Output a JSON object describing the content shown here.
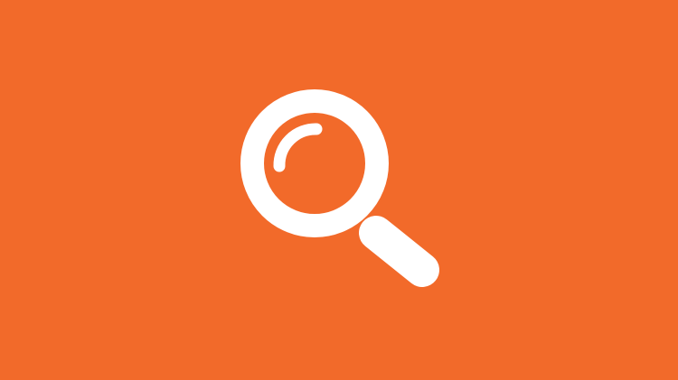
{
  "background": {
    "color": "#F26A2A"
  },
  "icon": {
    "name": "magnifying-glass",
    "color": "#FFFFFF"
  }
}
